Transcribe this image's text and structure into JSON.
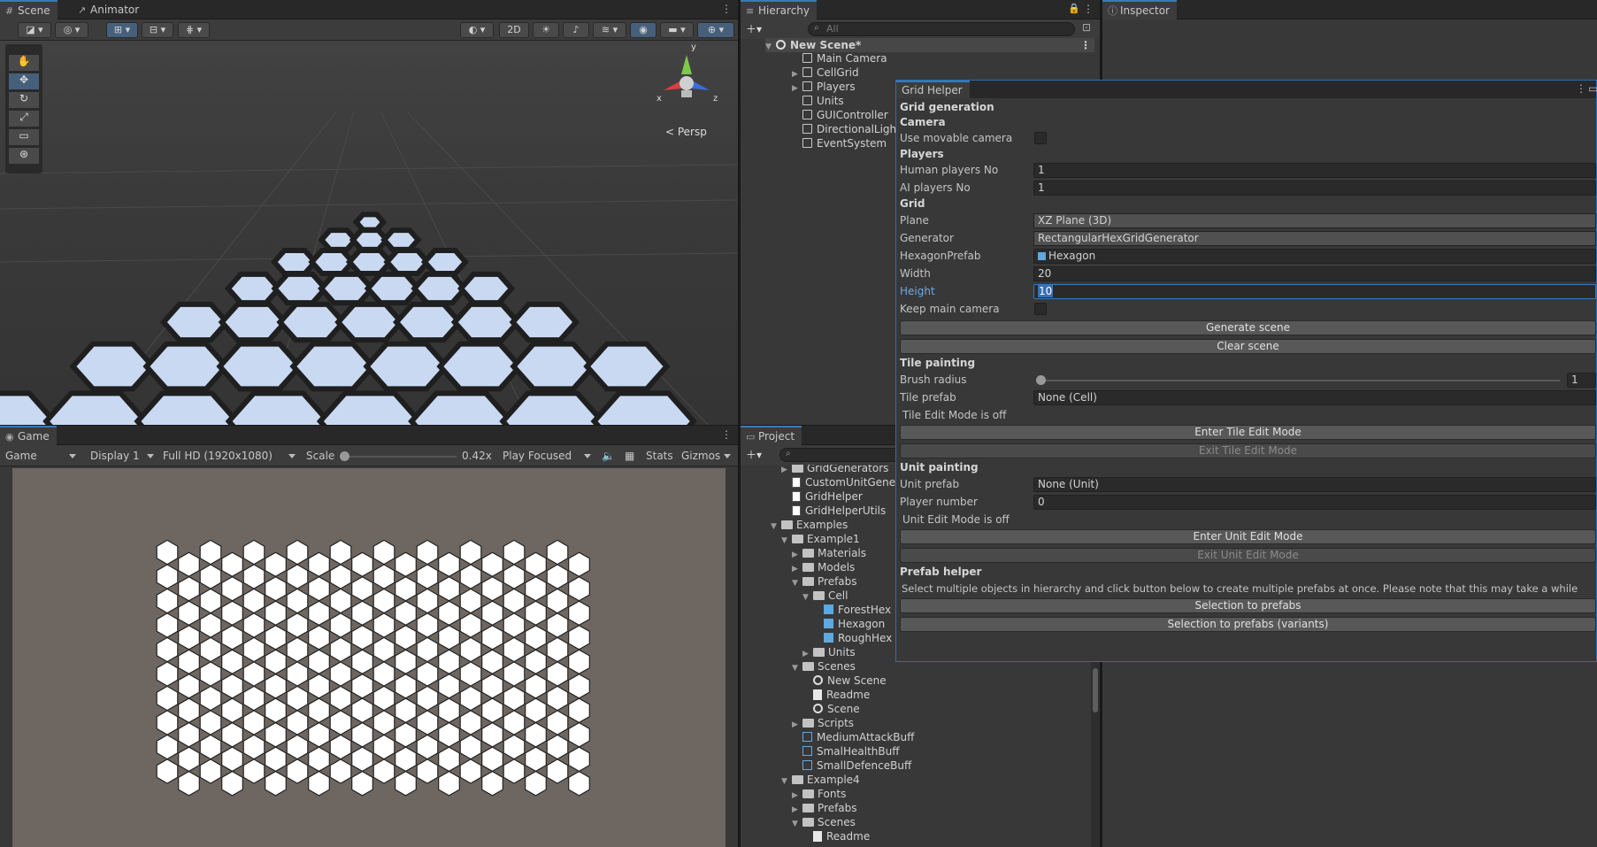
{
  "scene_panel": {
    "tabs": [
      {
        "label": "Scene",
        "icon": "hash-icon"
      },
      {
        "label": "Animator",
        "icon": "animator-icon"
      }
    ],
    "toolbar": {
      "mode_2d": "2D"
    },
    "persp_label": "< Persp",
    "gizmo_axes": {
      "y": "y",
      "x": "x",
      "z": "z"
    }
  },
  "game_panel": {
    "tab": "Game",
    "display_mode": "Game",
    "display": "Display 1",
    "resolution": "Full HD (1920x1080)",
    "scale_label": "Scale",
    "scale_value": "0.42x",
    "play_mode": "Play Focused",
    "stats": "Stats",
    "gizmos": "Gizmos"
  },
  "hierarchy": {
    "tab": "Hierarchy",
    "search_placeholder": "All",
    "scene_name": "New Scene*",
    "items": [
      "Main Camera",
      "CellGrid",
      "Players",
      "Units",
      "GUIController",
      "DirectionalLight",
      "EventSystem"
    ]
  },
  "inspector": {
    "tab": "Inspector"
  },
  "project": {
    "tab": "Project",
    "items": [
      "GridGenerators",
      "CustomUnitGener",
      "GridHelper",
      "GridHelperUtils",
      "Examples",
      "Example1",
      "Materials",
      "Models",
      "Prefabs",
      "Cell",
      "ForestHex",
      "Hexagon",
      "RoughHex",
      "Units",
      "Scenes",
      "New Scene",
      "Readme",
      "Scene",
      "Scripts",
      "MediumAttackBuff",
      "SmalHealthBuff",
      "SmallDefenceBuff",
      "Example4",
      "Fonts",
      "Prefabs",
      "Scenes",
      "Readme"
    ]
  },
  "grid_helper": {
    "title": "Grid Helper",
    "grid_generation": "Grid generation",
    "camera_header": "Camera",
    "use_movable_camera": "Use movable camera",
    "players_header": "Players",
    "human_players_label": "Human players No",
    "human_players_value": "1",
    "ai_players_label": "AI players No",
    "ai_players_value": "1",
    "grid_header": "Grid",
    "plane_label": "Plane",
    "plane_value": "XZ Plane (3D)",
    "generator_label": "Generator",
    "generator_value": "RectangularHexGridGenerator",
    "hexagon_prefab_label": "HexagonPrefab",
    "hexagon_prefab_value": "Hexagon",
    "width_label": "Width",
    "width_value": "20",
    "height_label": "Height",
    "height_value": "10",
    "keep_main_camera": "Keep main camera",
    "generate_scene": "Generate scene",
    "clear_scene": "Clear scene",
    "tile_painting_header": "Tile painting",
    "brush_radius_label": "Brush radius",
    "brush_radius_value": "1",
    "tile_prefab_label": "Tile prefab",
    "tile_prefab_value": "None (Cell)",
    "tile_edit_status": "Tile Edit Mode is off",
    "enter_tile_edit": "Enter Tile Edit Mode",
    "exit_tile_edit": "Exit Tile Edit Mode",
    "unit_painting_header": "Unit painting",
    "unit_prefab_label": "Unit prefab",
    "unit_prefab_value": "None (Unit)",
    "player_number_label": "Player number",
    "player_number_value": "0",
    "unit_edit_status": "Unit Edit Mode is off",
    "enter_unit_edit": "Enter Unit Edit Mode",
    "exit_unit_edit": "Exit Unit Edit Mode",
    "prefab_helper_header": "Prefab helper",
    "prefab_helper_note": "Select multiple objects in hierarchy and click button below to create multiple prefabs at once. Please note that this may take a while",
    "selection_to_prefabs": "Selection to prefabs",
    "selection_to_prefabs_variants": "Selection to prefabs (variants)"
  },
  "colors": {
    "accent": "#3a79bb",
    "hex_tile": "#c9d9f2",
    "game_bg": "#6e6660"
  }
}
